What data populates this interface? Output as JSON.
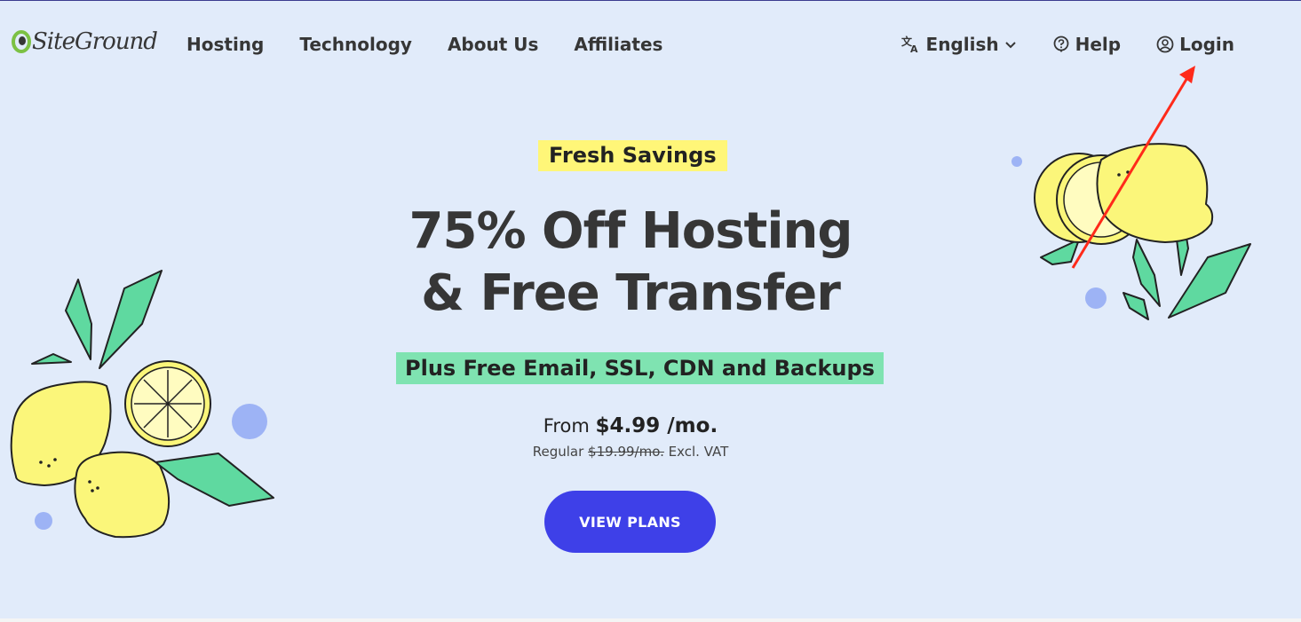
{
  "header": {
    "logo_text": "SiteGround",
    "nav": [
      "Hosting",
      "Technology",
      "About Us",
      "Affiliates"
    ],
    "language": "English",
    "help": "Help",
    "login": "Login"
  },
  "hero": {
    "badge": "Fresh Savings",
    "headline_line1": "75% Off Hosting",
    "headline_line2": "& Free Transfer",
    "subbadge": "Plus Free Email, SSL, CDN and Backups",
    "price_prefix": "From",
    "price": "$4.99 /mo.",
    "regular_label": "Regular",
    "regular_price": "$19.99/mo.",
    "regular_suffix": "Excl. VAT",
    "cta": "VIEW PLANS"
  },
  "colors": {
    "background": "#e1ebfa",
    "accent_button": "#3e40e8",
    "yellow_tag": "#fff678",
    "green_tag": "#7fe3b1",
    "lemon": "#fbf67a",
    "leaf": "#5fd9a0",
    "dot": "#9db3f5",
    "annotation_arrow": "#ff2a1a"
  },
  "icons": [
    "siteground-logo-icon",
    "translate-icon",
    "chevron-down-icon",
    "help-icon",
    "user-icon",
    "red-arrow-annotation"
  ]
}
